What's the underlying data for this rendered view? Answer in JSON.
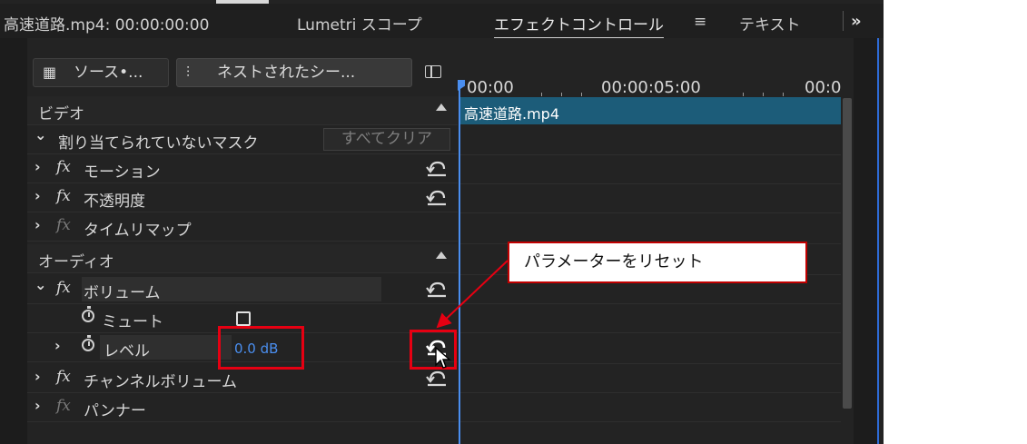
{
  "tabs": {
    "source": "高速道路.mp4: 00:00:00:00",
    "lumetri": "Lumetri スコープ",
    "effect_controls": "エフェクトコントロール",
    "menu_glyph": "≡",
    "text": "テキスト",
    "overflow_glyph": "»"
  },
  "source_buttons": {
    "source": "ソース•...",
    "nested": "ネストされたシー..."
  },
  "sections": {
    "video": "ビデオ",
    "unassigned_mask": "割り当てられていないマスク",
    "clear_all": "すべてクリア",
    "motion": "モーション",
    "opacity": "不透明度",
    "time_remap": "タイムリマップ",
    "audio": "オーディオ",
    "volume": "ボリューム",
    "mute": "ミュート",
    "level": "レベル",
    "level_value": "0.0 dB",
    "channel_volume": "チャンネルボリューム",
    "panner": "パンナー"
  },
  "glyphs": {
    "chevron_right": "›",
    "chevron_down": "⌄",
    "fx": "fx"
  },
  "timeline": {
    "t0": "00:00",
    "t1": "00:00:05:00",
    "t2": "00:0",
    "clip_name": "高速道路.mp4"
  },
  "annotation": {
    "callout": "パラメーターをリセット"
  },
  "colors": {
    "accent_blue": "#4a8eef",
    "clip": "#1c5c79",
    "highlight_red": "#e60012"
  },
  "icons": [
    "source-monitor-icon",
    "nest-icon",
    "panel-toggle-icon",
    "reset-icon",
    "stopwatch-icon",
    "checkbox",
    "mouse-cursor-icon"
  ]
}
